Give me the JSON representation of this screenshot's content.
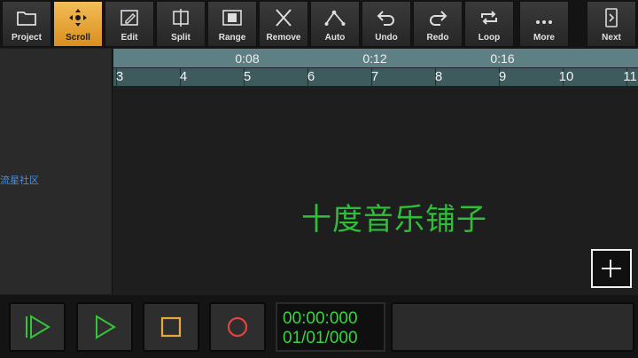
{
  "toolbar": {
    "tools": [
      {
        "label": "Project",
        "icon": "folder-icon"
      },
      {
        "label": "Scroll",
        "icon": "move-arrows-icon",
        "active": true
      },
      {
        "label": "Edit",
        "icon": "pencil-icon"
      },
      {
        "label": "Split",
        "icon": "split-icon"
      },
      {
        "label": "Range",
        "icon": "range-icon"
      },
      {
        "label": "Remove",
        "icon": "x-icon"
      },
      {
        "label": "Auto",
        "icon": "automation-icon"
      },
      {
        "label": "Undo",
        "icon": "undo-icon"
      },
      {
        "label": "Redo",
        "icon": "redo-icon"
      },
      {
        "label": "Loop",
        "icon": "loop-icon"
      },
      {
        "label": "More",
        "icon": "more-dots-icon"
      }
    ],
    "next_label": "Next"
  },
  "ruler": {
    "times": [
      "0:08",
      "0:12",
      "0:16"
    ],
    "bars": [
      "3",
      "4",
      "5",
      "6",
      "7",
      "8",
      "9",
      "10",
      "11"
    ]
  },
  "trackpanel": {
    "watermark": "流星社区"
  },
  "trackarea": {
    "overlay_text": "十度音乐铺子"
  },
  "transport": {
    "counter_time": "00:00:000",
    "counter_bar": "01/01/000",
    "colors": {
      "play": "#35c23c",
      "stop": "#e5a83c",
      "record": "#e0443e",
      "counter": "#35d63f"
    }
  }
}
